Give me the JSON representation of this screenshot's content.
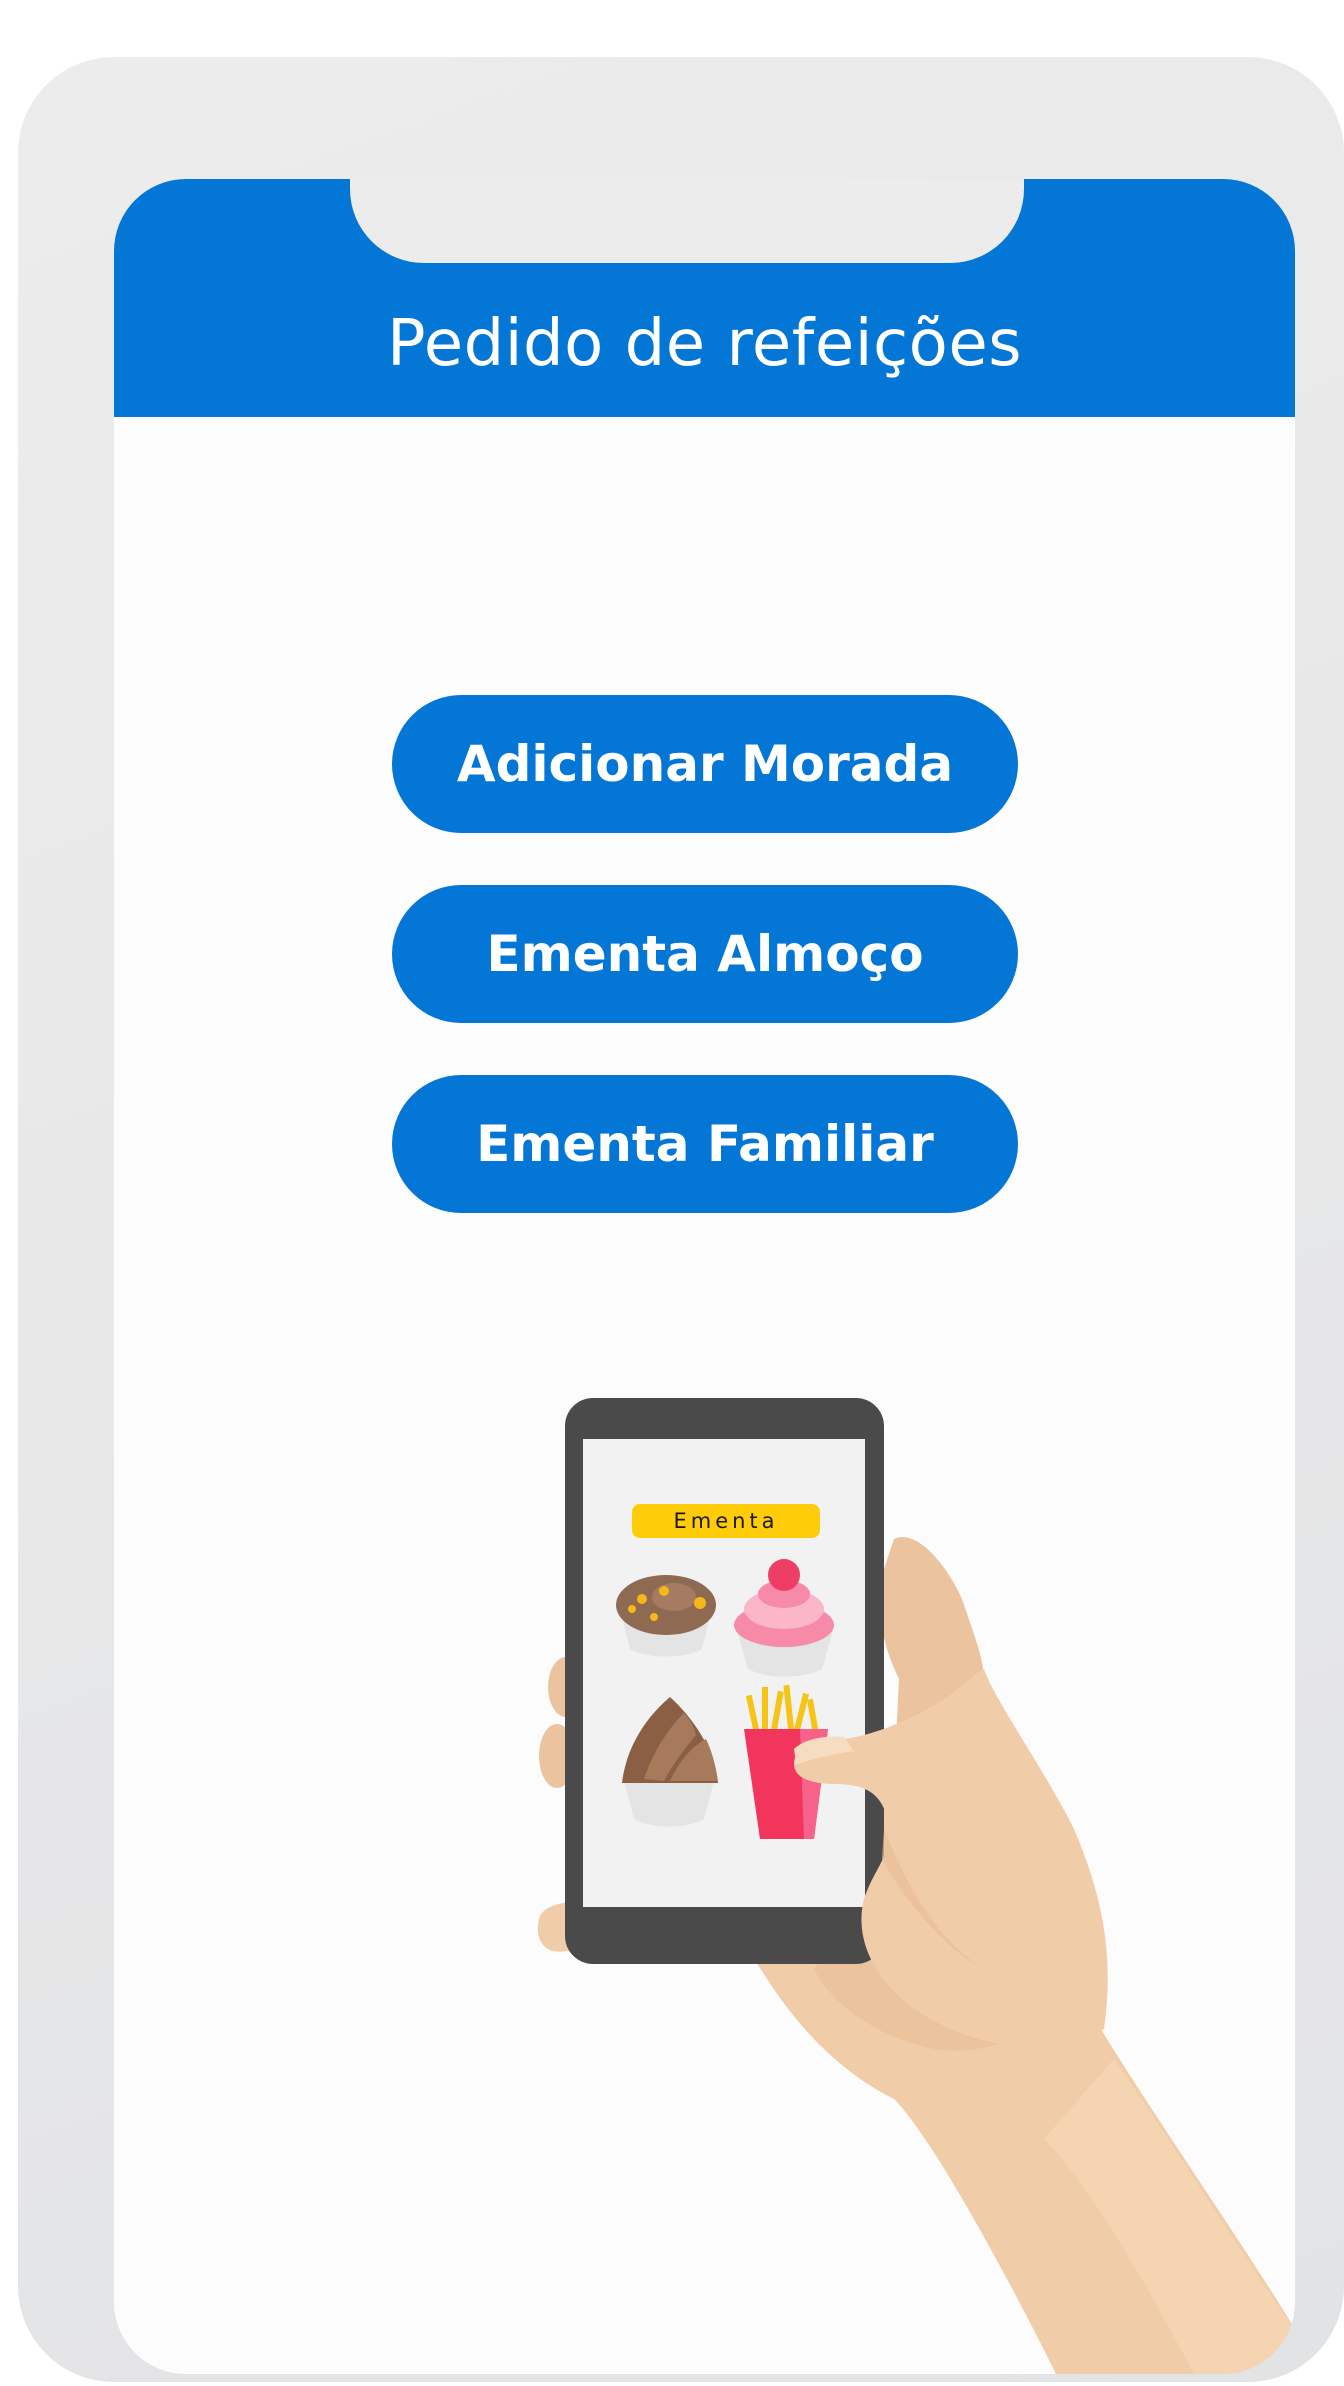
{
  "header": {
    "title": "Pedido de refeições",
    "background_color": "#0476d6"
  },
  "menu": {
    "buttons": [
      {
        "label": "Adicionar Morada"
      },
      {
        "label": "Ementa Almoço"
      },
      {
        "label": "Ementa Familiar"
      }
    ],
    "button_color": "#0476d6"
  },
  "illustration": {
    "phone_badge": "Ementa",
    "badge_color": "#ffcc0a",
    "food_icons": [
      "muffin-icon",
      "cupcake-icon",
      "chocolate-cupcake-icon",
      "french-fries-icon"
    ],
    "subject": "hand-holding-phone"
  }
}
